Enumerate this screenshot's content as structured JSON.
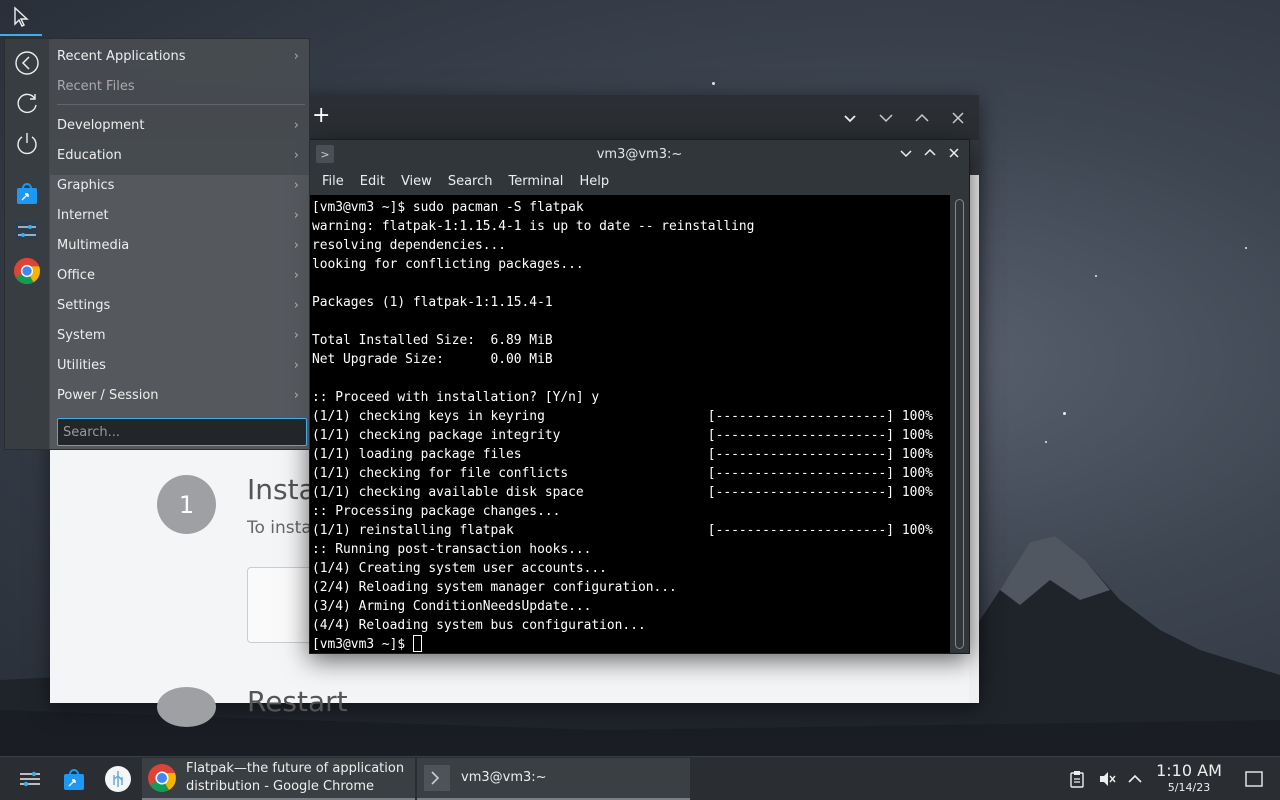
{
  "launcher": {
    "categories": [
      {
        "label": "Recent Applications"
      },
      {
        "label": "Recent Files"
      },
      {
        "label": "Development"
      },
      {
        "label": "Education"
      },
      {
        "label": "Graphics"
      },
      {
        "label": "Internet"
      },
      {
        "label": "Multimedia"
      },
      {
        "label": "Office"
      },
      {
        "label": "Settings"
      },
      {
        "label": "System"
      },
      {
        "label": "Utilities"
      },
      {
        "label": "Power / Session"
      }
    ],
    "search_placeholder": "Search..."
  },
  "chrome_page": {
    "step1_number": "1",
    "step1_title": "Insta",
    "step1_sub": "To insta",
    "step2_title": "Restart"
  },
  "konsole": {
    "title": "vm3@vm3:~",
    "menu": [
      "File",
      "Edit",
      "View",
      "Search",
      "Terminal",
      "Help"
    ],
    "lines": [
      "[vm3@vm3 ~]$ sudo pacman -S flatpak",
      "warning: flatpak-1:1.15.4-1 is up to date -- reinstalling",
      "resolving dependencies...",
      "looking for conflicting packages...",
      "",
      "Packages (1) flatpak-1:1.15.4-1",
      "",
      "Total Installed Size:  6.89 MiB",
      "Net Upgrade Size:      0.00 MiB",
      "",
      ":: Proceed with installation? [Y/n] y",
      "(1/1) checking keys in keyring                     [----------------------] 100%",
      "(1/1) checking package integrity                   [----------------------] 100%",
      "(1/1) loading package files                        [----------------------] 100%",
      "(1/1) checking for file conflicts                  [----------------------] 100%",
      "(1/1) checking available disk space                [----------------------] 100%",
      ":: Processing package changes...",
      "(1/1) reinstalling flatpak                         [----------------------] 100%",
      ":: Running post-transaction hooks...",
      "(1/4) Creating system user accounts...",
      "(2/4) Reloading system manager configuration...",
      "(3/4) Arming ConditionNeedsUpdate...",
      "(4/4) Reloading system bus configuration..."
    ],
    "prompt": "[vm3@vm3 ~]$ "
  },
  "taskbar": {
    "chrome_task_label_line1": "Flatpak—the future of application",
    "chrome_task_label_line2": "distribution - Google Chrome",
    "konsole_task_label": "vm3@vm3:~",
    "time": "1:10 AM",
    "date": "5/14/23"
  },
  "colors": {
    "accent": "#3daee9",
    "panel": "#2a2e32"
  }
}
